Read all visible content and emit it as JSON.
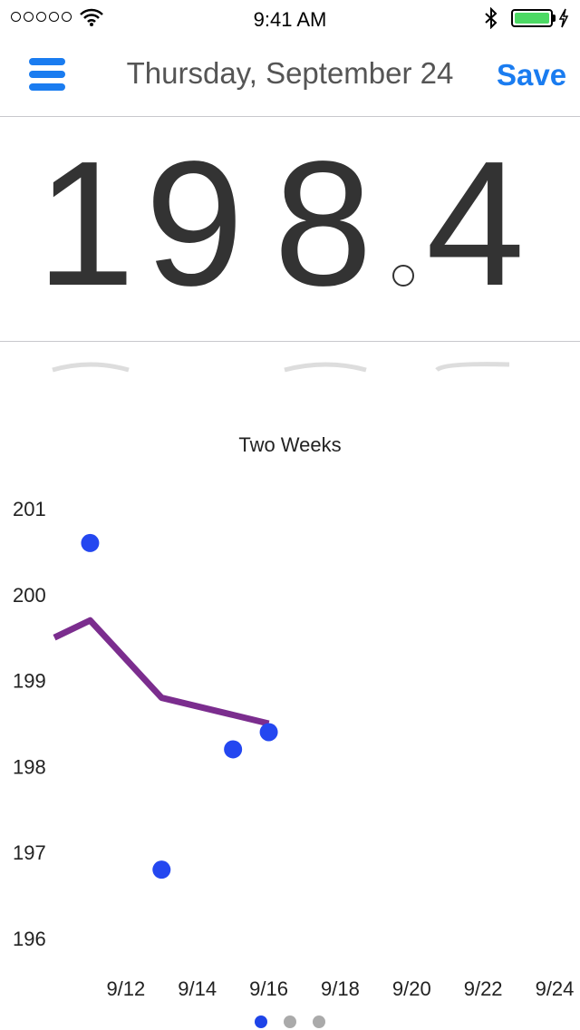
{
  "status_bar": {
    "time": "9:41 AM",
    "icons": [
      "signal-dots",
      "wifi-icon",
      "bluetooth-icon",
      "battery-icon",
      "charging-bolt-icon"
    ],
    "battery_color": "#4cd964"
  },
  "header": {
    "title": "Thursday, September 24",
    "save_label": "Save",
    "accent_color": "#1a7cf0"
  },
  "weight": {
    "digits": [
      "1",
      "9",
      "8",
      "4"
    ]
  },
  "chart_title": "Two Weeks",
  "chart_data": {
    "type": "line",
    "title": "Two Weeks",
    "xlabel": "",
    "ylabel": "",
    "x_ticks": [
      "9/12",
      "9/14",
      "9/16",
      "9/18",
      "9/20",
      "9/22",
      "9/24"
    ],
    "y_ticks": [
      196,
      197,
      198,
      199,
      200,
      201
    ],
    "ylim": [
      196,
      201
    ],
    "xlim": [
      "9/10",
      "9/24"
    ],
    "grid": false,
    "series": [
      {
        "type": "scatter",
        "color": "#2447f0",
        "points": [
          {
            "x": "9/11",
            "y": 200.6
          },
          {
            "x": "9/13",
            "y": 196.8
          },
          {
            "x": "9/15",
            "y": 198.2
          },
          {
            "x": "9/16",
            "y": 198.4
          }
        ]
      },
      {
        "type": "line",
        "color": "#7b2d8e",
        "points": [
          {
            "x": "9/10",
            "y": 199.5
          },
          {
            "x": "9/11",
            "y": 199.7
          },
          {
            "x": "9/13",
            "y": 198.8
          },
          {
            "x": "9/15",
            "y": 198.6
          },
          {
            "x": "9/16",
            "y": 198.5
          }
        ]
      }
    ]
  },
  "pagination": {
    "count": 3,
    "active_index": 0
  }
}
